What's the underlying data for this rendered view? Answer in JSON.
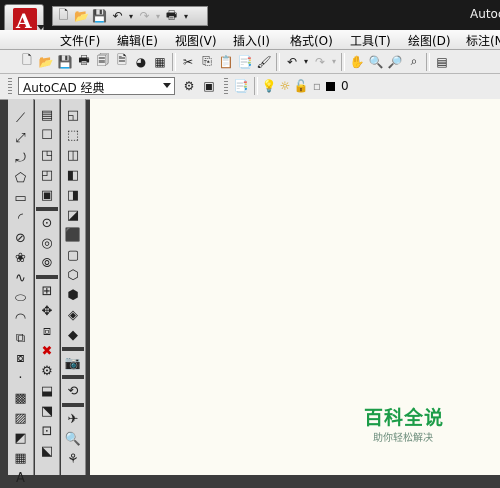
{
  "window": {
    "title": "Autoc"
  },
  "menu": [
    {
      "label": "文件(F)"
    },
    {
      "label": "编辑(E)"
    },
    {
      "label": "视图(V)"
    },
    {
      "label": "插入(I)"
    },
    {
      "label": "格式(O)"
    },
    {
      "label": "工具(T)"
    },
    {
      "label": "绘图(D)"
    },
    {
      "label": "标注(N"
    }
  ],
  "workspace": {
    "value": "AutoCAD 经典"
  },
  "layer": {
    "value": "0"
  },
  "watermark": {
    "title": "百科全说",
    "subtitle": "助你轻松解决"
  }
}
